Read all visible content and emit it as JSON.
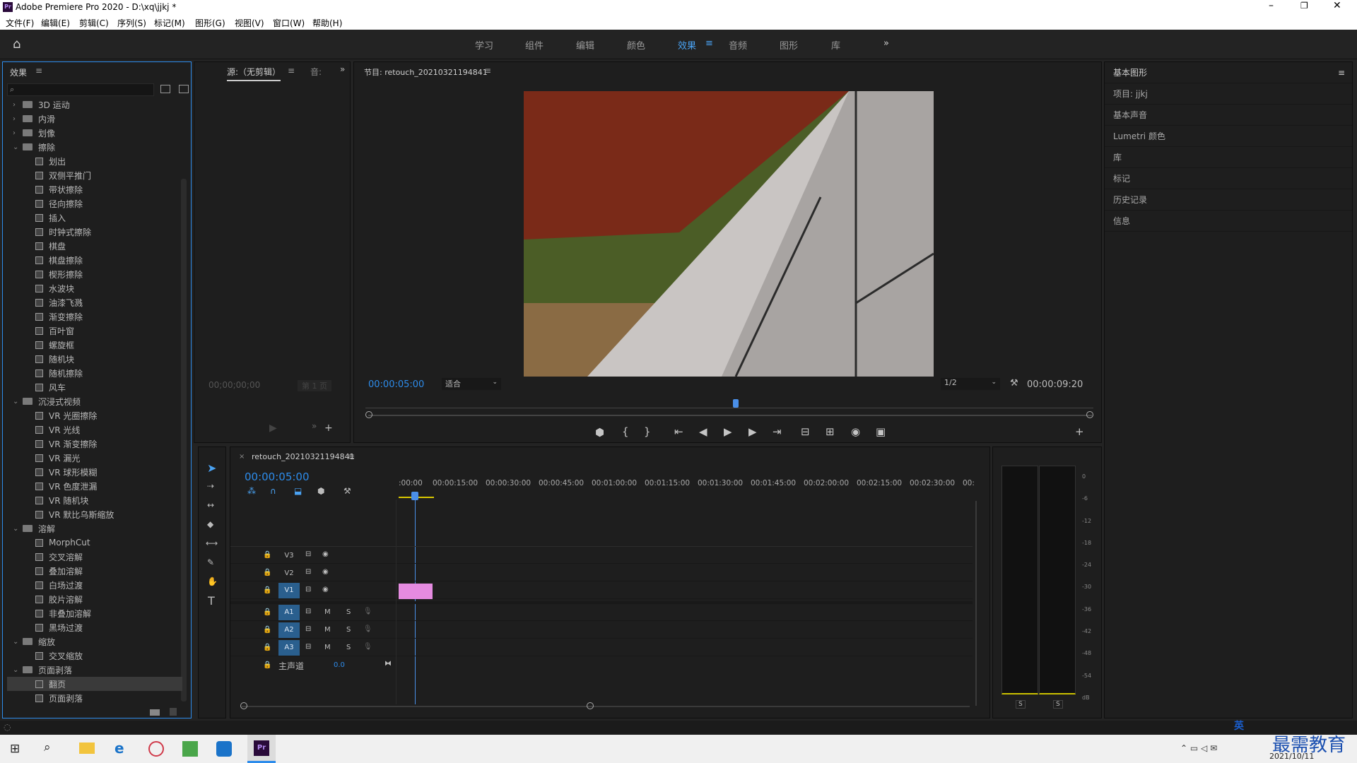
{
  "titlebar": {
    "title": "Adobe Premiere Pro 2020 - D:\\xq\\jjkj *",
    "logo": "Pr"
  },
  "menu": [
    "文件(F)",
    "编辑(E)",
    "剪辑(C)",
    "序列(S)",
    "标记(M)",
    "图形(G)",
    "视图(V)",
    "窗口(W)",
    "帮助(H)"
  ],
  "workspaces": [
    "学习",
    "组件",
    "编辑",
    "颜色",
    "效果",
    "音频",
    "图形",
    "库"
  ],
  "active_workspace": "效果",
  "effects": {
    "title": "效果",
    "items": [
      {
        "t": "folder",
        "label": "3D 运动",
        "open": false,
        "lv": 0
      },
      {
        "t": "folder",
        "label": "内滑",
        "open": false,
        "lv": 0
      },
      {
        "t": "folder",
        "label": "划像",
        "open": false,
        "lv": 0
      },
      {
        "t": "folder",
        "label": "擦除",
        "open": true,
        "lv": 0
      },
      {
        "t": "fx",
        "label": "划出",
        "lv": 1
      },
      {
        "t": "fx",
        "label": "双侧平推门",
        "lv": 1
      },
      {
        "t": "fx",
        "label": "带状擦除",
        "lv": 1
      },
      {
        "t": "fx",
        "label": "径向擦除",
        "lv": 1
      },
      {
        "t": "fx",
        "label": "插入",
        "lv": 1
      },
      {
        "t": "fx",
        "label": "时钟式擦除",
        "lv": 1
      },
      {
        "t": "fx",
        "label": "棋盘",
        "lv": 1
      },
      {
        "t": "fx",
        "label": "棋盘擦除",
        "lv": 1
      },
      {
        "t": "fx",
        "label": "楔形擦除",
        "lv": 1
      },
      {
        "t": "fx",
        "label": "水波块",
        "lv": 1
      },
      {
        "t": "fx",
        "label": "油漆飞溅",
        "lv": 1
      },
      {
        "t": "fx",
        "label": "渐变擦除",
        "lv": 1
      },
      {
        "t": "fx",
        "label": "百叶窗",
        "lv": 1
      },
      {
        "t": "fx",
        "label": "螺旋框",
        "lv": 1
      },
      {
        "t": "fx",
        "label": "随机块",
        "lv": 1
      },
      {
        "t": "fx",
        "label": "随机擦除",
        "lv": 1
      },
      {
        "t": "fx",
        "label": "风车",
        "lv": 1
      },
      {
        "t": "folder",
        "label": "沉浸式视频",
        "open": true,
        "lv": 0
      },
      {
        "t": "fx",
        "label": "VR 光圈擦除",
        "lv": 1
      },
      {
        "t": "fx",
        "label": "VR 光线",
        "lv": 1
      },
      {
        "t": "fx",
        "label": "VR 渐变擦除",
        "lv": 1
      },
      {
        "t": "fx",
        "label": "VR 漏光",
        "lv": 1
      },
      {
        "t": "fx",
        "label": "VR 球形模糊",
        "lv": 1
      },
      {
        "t": "fx",
        "label": "VR 色度泄漏",
        "lv": 1
      },
      {
        "t": "fx",
        "label": "VR 随机块",
        "lv": 1
      },
      {
        "t": "fx",
        "label": "VR 默比乌斯缩放",
        "lv": 1
      },
      {
        "t": "folder",
        "label": "溶解",
        "open": true,
        "lv": 0
      },
      {
        "t": "fx",
        "label": "MorphCut",
        "lv": 1
      },
      {
        "t": "fx",
        "label": "交叉溶解",
        "lv": 1
      },
      {
        "t": "fx",
        "label": "叠加溶解",
        "lv": 1
      },
      {
        "t": "fx",
        "label": "白场过渡",
        "lv": 1
      },
      {
        "t": "fx",
        "label": "胶片溶解",
        "lv": 1
      },
      {
        "t": "fx",
        "label": "非叠加溶解",
        "lv": 1
      },
      {
        "t": "fx",
        "label": "黑场过渡",
        "lv": 1
      },
      {
        "t": "folder",
        "label": "缩放",
        "open": true,
        "lv": 0
      },
      {
        "t": "fx",
        "label": "交叉缩放",
        "lv": 1
      },
      {
        "t": "folder",
        "label": "页面剥落",
        "open": true,
        "lv": 0
      },
      {
        "t": "fx",
        "label": "翻页",
        "lv": 1,
        "sel": true
      },
      {
        "t": "fx",
        "label": "页面剥落",
        "lv": 1
      }
    ]
  },
  "source": {
    "tab": "源:（无剪辑）",
    "tab2": "音:",
    "timecode": "00;00;00;00",
    "page": "第 1 页"
  },
  "program": {
    "title": "节目: retouch_20210321194841",
    "timecode": "00:00:05:00",
    "fit": "适合",
    "res": "1/2",
    "duration": "00:00:09:20"
  },
  "timeline": {
    "seq": "retouch_20210321194841",
    "timecode": "00:00:05:00",
    "ruler": [
      ":00:00",
      "00:00:15:00",
      "00:00:30:00",
      "00:00:45:00",
      "00:01:00:00",
      "00:01:15:00",
      "00:01:30:00",
      "00:01:45:00",
      "00:02:00:00",
      "00:02:15:00",
      "00:02:30:00",
      "00:"
    ],
    "tracks": [
      "V3",
      "V2",
      "V1",
      "A1",
      "A2",
      "A3"
    ],
    "master": "主声道",
    "master_val": "0.0",
    "m": "M",
    "s": "S"
  },
  "meter": {
    "scale": [
      "0",
      "-6",
      "-12",
      "-18",
      "-24",
      "-30",
      "-36",
      "-42",
      "-48",
      "-54",
      "dB"
    ],
    "solo": [
      "S",
      "S"
    ]
  },
  "right": [
    "基本图形",
    "项目: jjkj",
    "基本声音",
    "Lumetri 颜色",
    "库",
    "标记",
    "历史记录",
    "信息"
  ],
  "taskbar": {
    "time": "2021/10/11",
    "ime": "英",
    "watermark": "最需教育"
  },
  "colors": {
    "accent": "#2d8ceb",
    "clip": "#e58be0",
    "active": "#4aa2f2"
  }
}
